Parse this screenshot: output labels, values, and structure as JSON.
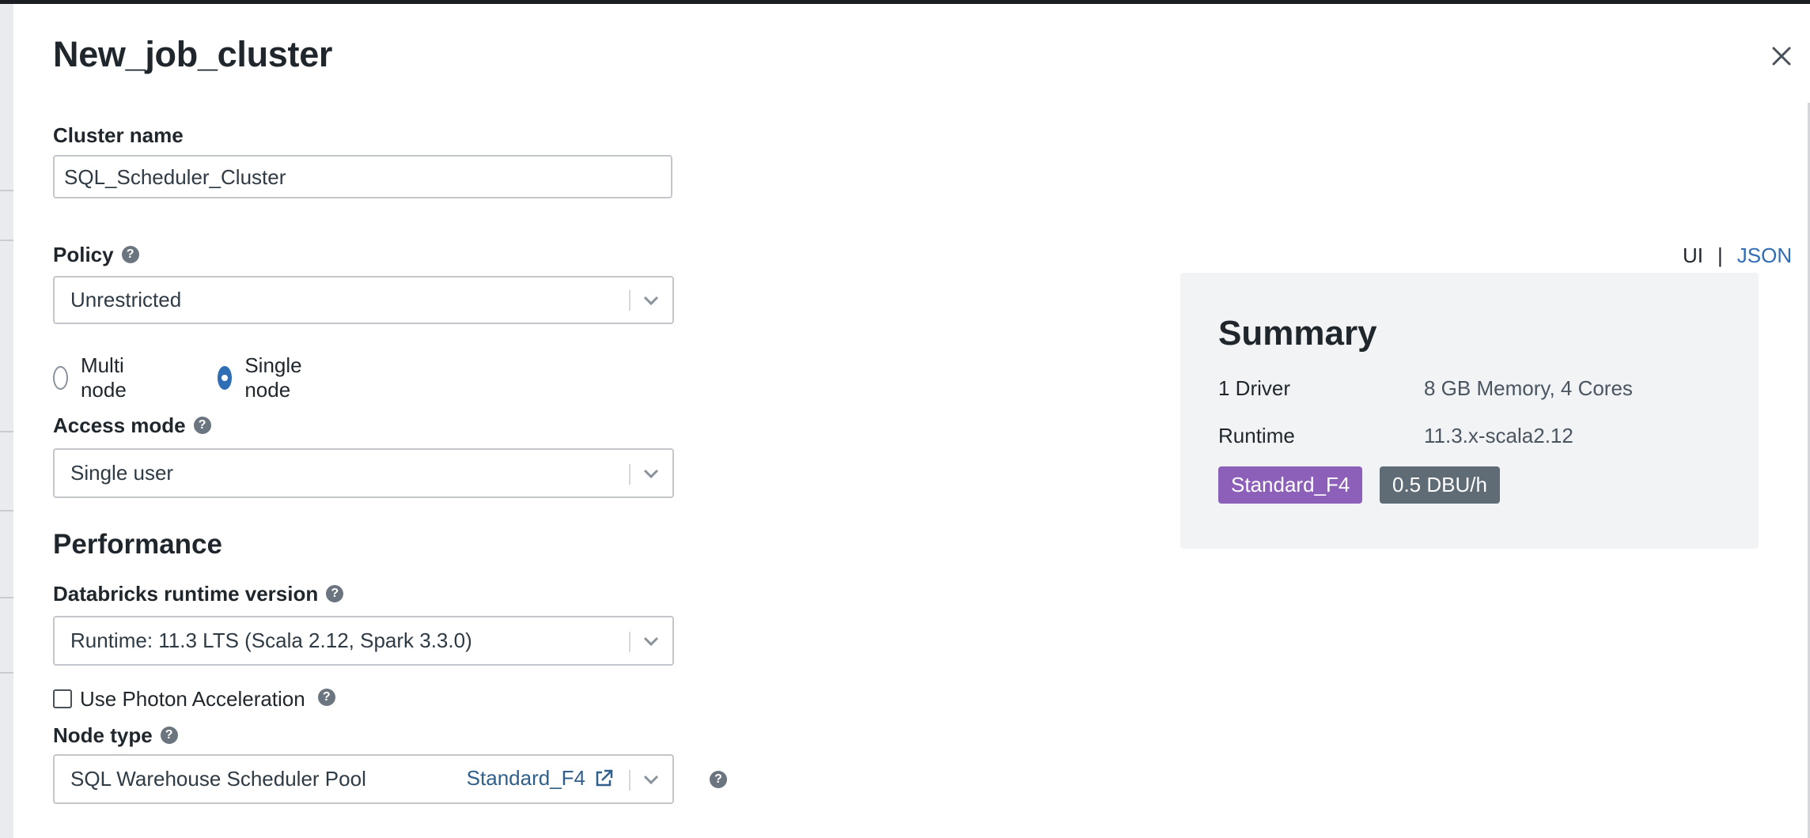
{
  "modal": {
    "title": "New_job_cluster"
  },
  "form": {
    "cluster_name_label": "Cluster name",
    "cluster_name_value": "SQL_Scheduler_Cluster",
    "policy_label": "Policy",
    "policy_value": "Unrestricted",
    "node_mode_options": [
      {
        "label": "Multi node",
        "selected": false
      },
      {
        "label": "Single node",
        "selected": true
      }
    ],
    "access_mode_label": "Access mode",
    "access_mode_value": "Single user",
    "performance_title": "Performance",
    "runtime_label": "Databricks runtime version",
    "runtime_value": "Runtime: 11.3 LTS (Scala 2.12, Spark 3.3.0)",
    "photon_label": "Use Photon Acceleration",
    "photon_checked": false,
    "node_type_label": "Node type",
    "node_type_value": "SQL Warehouse Scheduler Pool",
    "node_type_link": "Standard_F4"
  },
  "view_toggle": {
    "ui_label": "UI",
    "separator": "|",
    "json_label": "JSON"
  },
  "summary": {
    "title": "Summary",
    "rows": [
      {
        "label": "1 Driver",
        "value": "8 GB Memory, 4 Cores"
      },
      {
        "label": "Runtime",
        "value": "11.3.x-scala2.12"
      }
    ],
    "badges": [
      {
        "label": "Standard_F4",
        "color": "#8c5fb8"
      },
      {
        "label": "0.5 DBU/h",
        "color": "#5f6b75"
      }
    ]
  },
  "colors": {
    "accent": "#2f6db5",
    "link": "#2f5f8a",
    "help_icon": "#6b7580"
  },
  "icons": {
    "close": "close-icon",
    "help": "help-icon",
    "chevron": "chevron-down-icon",
    "external": "external-link-icon"
  }
}
